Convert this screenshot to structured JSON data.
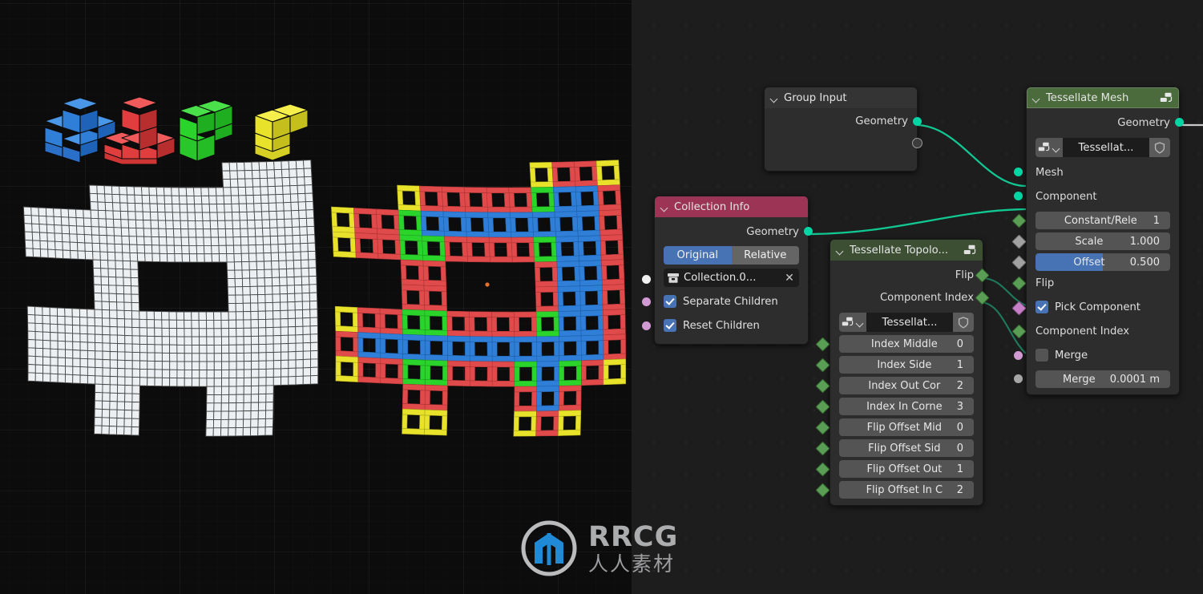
{
  "viewport": {
    "name": "3d-viewport",
    "background_color": "#0c0c0c",
    "origin_marker_color": "#e5722a",
    "source_mesh_color": "#eceff1",
    "components": [
      {
        "name": "plus-piece",
        "color": "#2f7ed8",
        "label": "Blue Plus Tetromino"
      },
      {
        "name": "j-piece",
        "color": "#e03e3e",
        "label": "Red J Tetromino"
      },
      {
        "name": "s-piece",
        "color": "#2bd42b",
        "label": "Green S Tetromino"
      },
      {
        "name": "l-piece",
        "color": "#e8e22b",
        "label": "Yellow L Tetromino"
      }
    ],
    "result_colors": {
      "middle": "#2f7ed8",
      "side": "#e04a4a",
      "outer_corner": "#e8e22b",
      "inner_corner": "#2bd42b"
    }
  },
  "node_editor": {
    "name": "geometry-node-editor",
    "background_color": "#1d1d1d",
    "link_color": "#00c896",
    "nodes": [
      {
        "id": "group-input",
        "title": "Group Input",
        "header_color": "#2e2e2e",
        "outputs": [
          {
            "label": "Geometry",
            "socket": "geometry",
            "color": "#00d6a3"
          },
          {
            "label": "",
            "socket": "virtual",
            "color": "#9a9a9a"
          }
        ]
      },
      {
        "id": "collection-info",
        "title": "Collection Info",
        "header_color": "#9c3456",
        "outputs": [
          {
            "label": "Geometry",
            "socket": "geometry",
            "color": "#00d6a3"
          }
        ],
        "transform_space": {
          "options": [
            "Original",
            "Relative"
          ],
          "selected": "Original"
        },
        "collection_field": {
          "icon": "collection-icon",
          "value": "Collection.0...",
          "clear_label": "✕"
        },
        "checkboxes": [
          {
            "label": "Separate Children",
            "checked": true,
            "socket_color": "#d29ad3"
          },
          {
            "label": "Reset Children",
            "checked": true,
            "socket_color": "#d29ad3"
          }
        ]
      },
      {
        "id": "tessellate-topology",
        "title": "Tessellate Topolo...",
        "header_color": "#3c4f33",
        "header_icon": "node-group-icon",
        "outputs": [
          {
            "label": "Flip",
            "socket": "field",
            "color": "#5a9e55"
          },
          {
            "label": "Component Index",
            "socket": "field",
            "color": "#5a9e55"
          }
        ],
        "node_group": {
          "icon": "node-group-icon",
          "name": "Tessellat...",
          "shield": "shield-icon"
        },
        "fields": [
          {
            "label": "Index Middle",
            "value": "0",
            "socket": "field"
          },
          {
            "label": "Index Side",
            "value": "1",
            "socket": "field"
          },
          {
            "label": "Index Out Cor",
            "value": "2",
            "socket": "field"
          },
          {
            "label": "Index In Corne",
            "value": "3",
            "socket": "field"
          },
          {
            "label": "Flip Offset Mid",
            "value": "0",
            "socket": "field"
          },
          {
            "label": "Flip Offset Sid",
            "value": "0",
            "socket": "field"
          },
          {
            "label": "Flip Offset Out",
            "value": "1",
            "socket": "field"
          },
          {
            "label": "Flip Offset In C",
            "value": "2",
            "socket": "field"
          }
        ]
      },
      {
        "id": "tessellate-mesh",
        "title": "Tessellate Mesh",
        "header_color": "#4b6b3c",
        "header_icon": "node-group-icon",
        "selected": true,
        "outputs": [
          {
            "label": "Geometry",
            "socket": "geometry",
            "color": "#00d6a3"
          }
        ],
        "node_group": {
          "icon": "node-group-icon",
          "name": "Tessellat...",
          "shield": "shield-icon"
        },
        "inputs": [
          {
            "label": "Mesh",
            "socket": "geometry",
            "kind": "plain"
          },
          {
            "label": "Component",
            "socket": "geometry",
            "kind": "plain"
          },
          {
            "label": "Constant/Rele",
            "value": "1",
            "socket": "field",
            "kind": "field"
          },
          {
            "label": "Scale",
            "value": "1.000",
            "socket": "value",
            "kind": "field"
          },
          {
            "label": "Offset",
            "value": "0.500",
            "socket": "value",
            "kind": "slider",
            "fill": 0.5
          },
          {
            "label": "Flip",
            "socket": "field",
            "kind": "plain"
          },
          {
            "label": "Pick Component",
            "socket": "bool-field",
            "kind": "checkbox",
            "checked": true
          },
          {
            "label": "Component Index",
            "socket": "field",
            "kind": "plain"
          },
          {
            "label": "Merge",
            "socket": "bool",
            "kind": "checkbox",
            "checked": false
          },
          {
            "label": "Merge",
            "value": "0.0001 m",
            "socket": "value-circ",
            "kind": "field"
          }
        ]
      }
    ]
  },
  "watermark": {
    "name": "rrcg-watermark",
    "brand": "RRCG",
    "subtitle": "人人素材",
    "logo_color": "#2196e8",
    "ring_color": "#c9cacc"
  }
}
